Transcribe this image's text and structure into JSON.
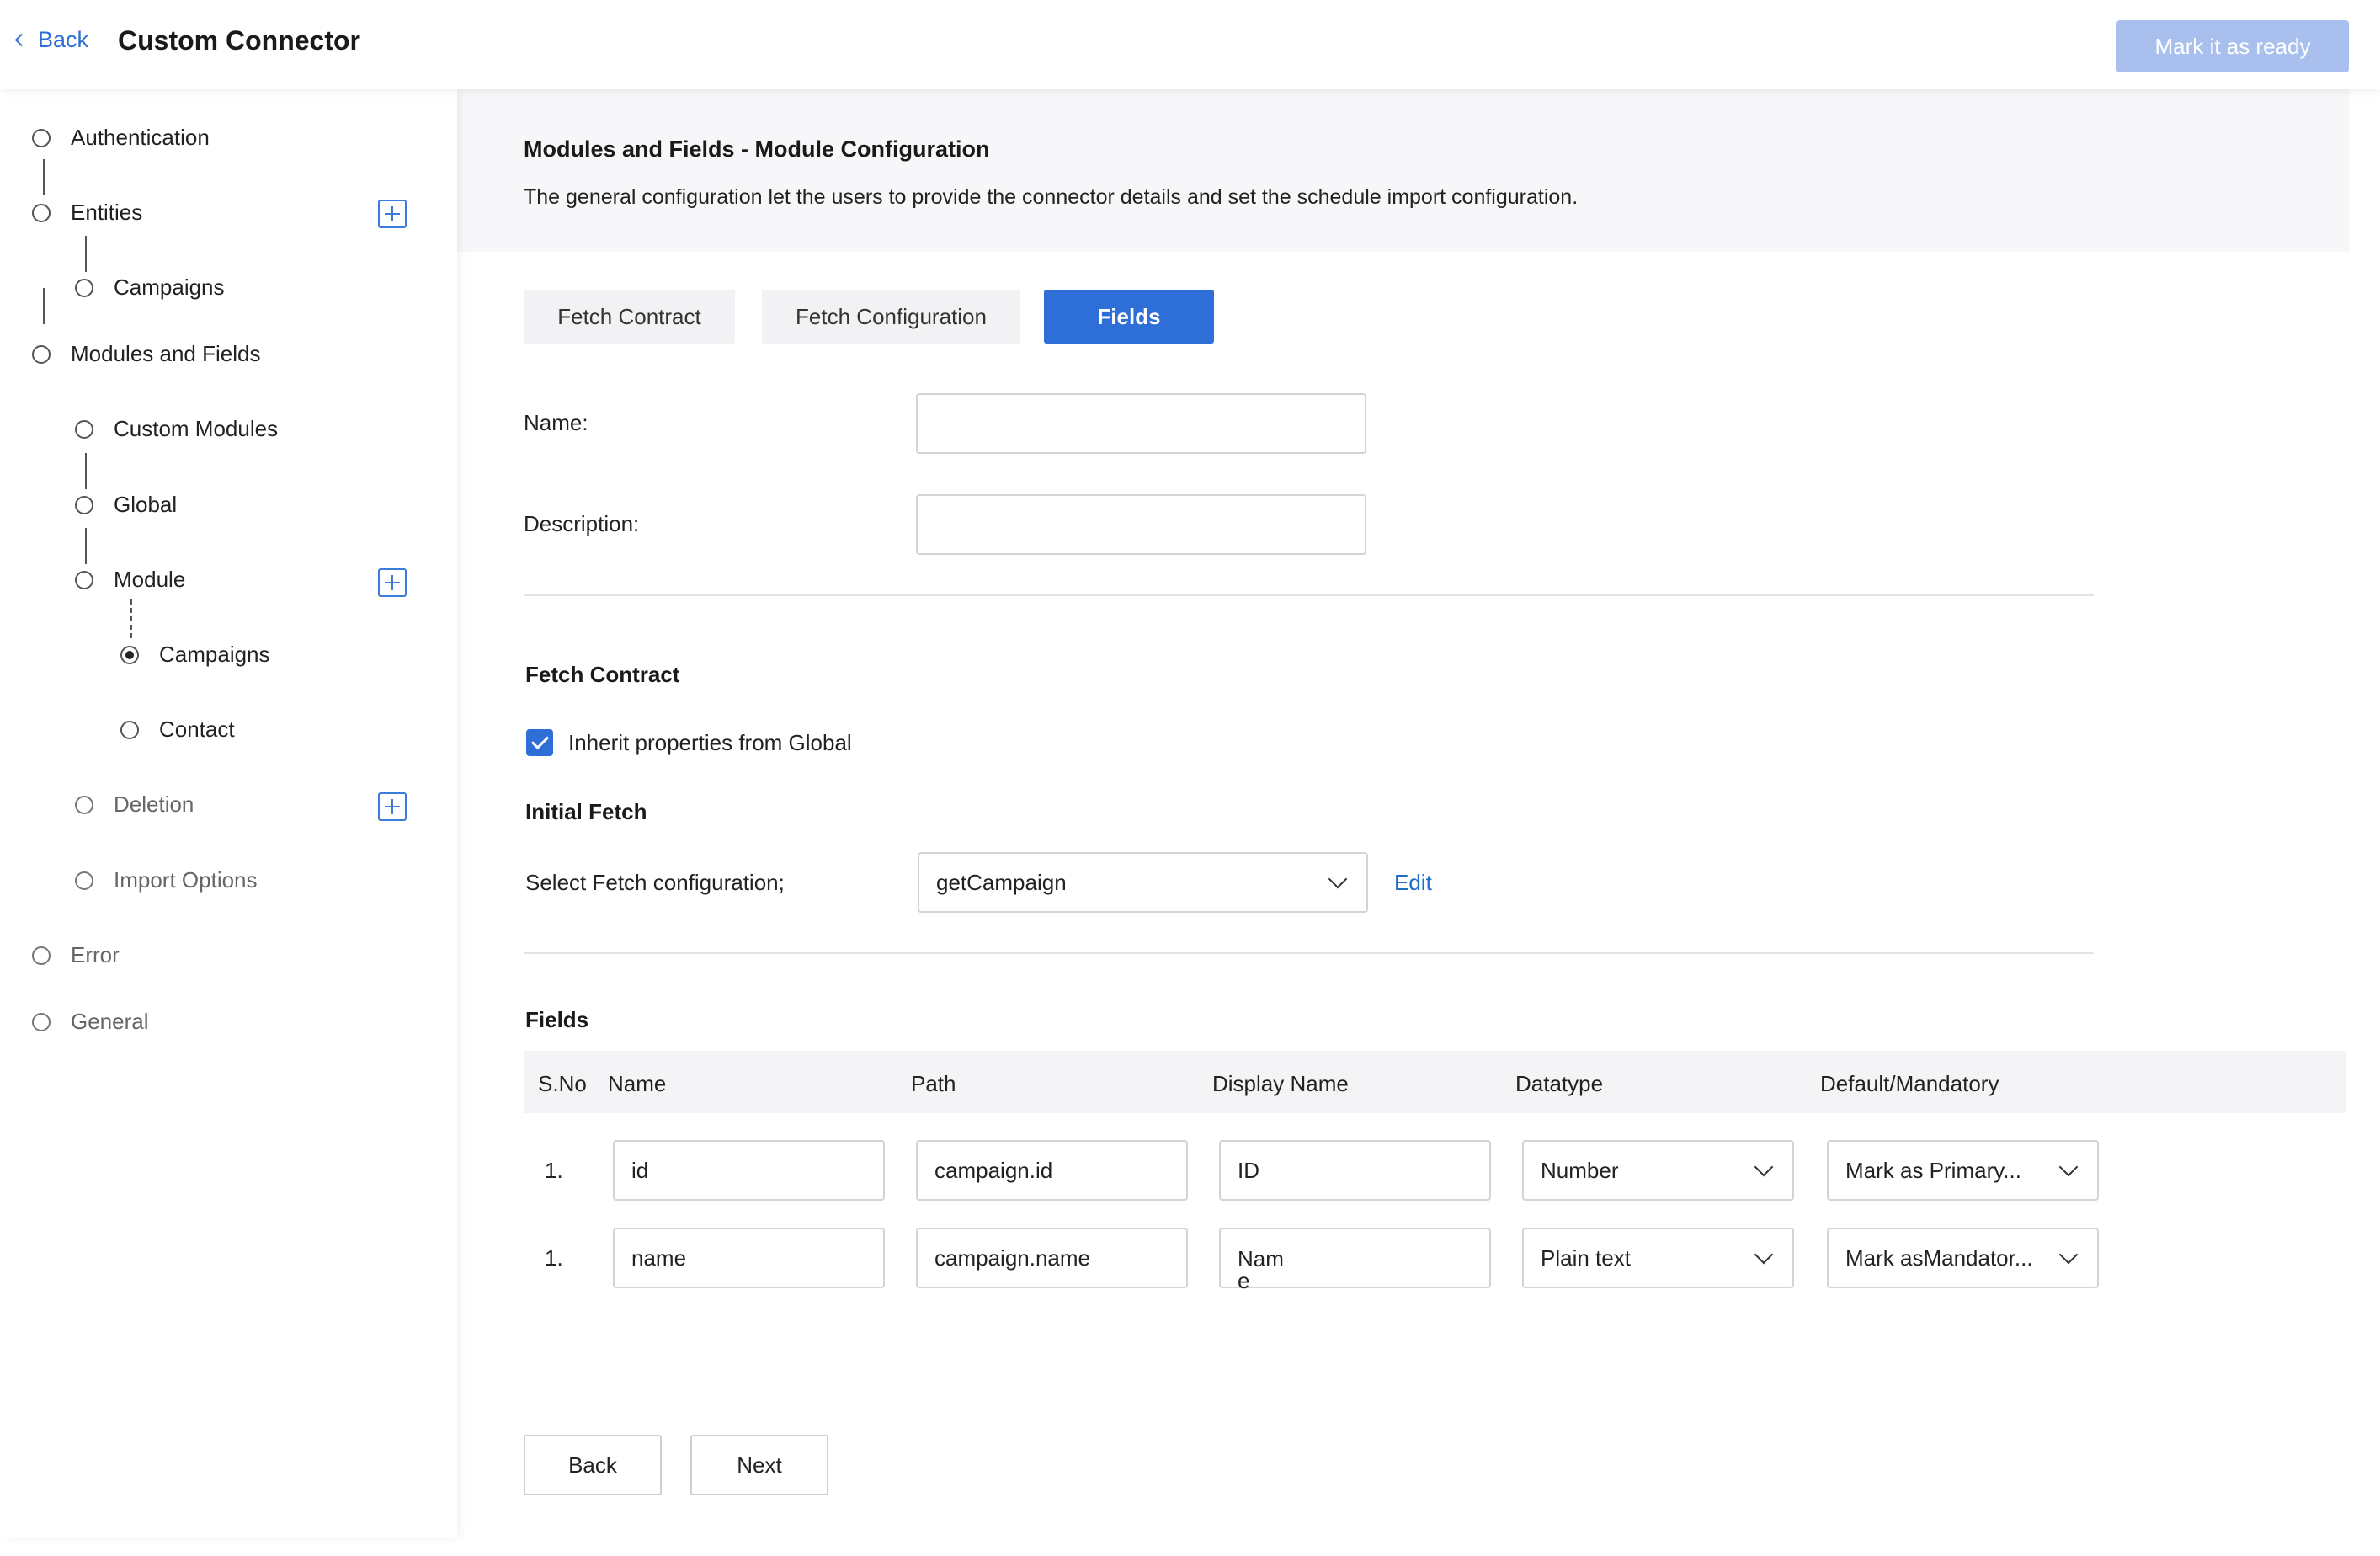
{
  "header": {
    "back_label": "Back",
    "title": "Custom Connector",
    "ready_label": "Mark it as ready"
  },
  "sidebar": {
    "authentication": "Authentication",
    "entities": "Entities",
    "entities_campaigns": "Campaigns",
    "modules_and_fields": "Modules and Fields",
    "custom_modules": "Custom Modules",
    "global": "Global",
    "module": "Module",
    "module_campaigns": "Campaigns",
    "module_contact": "Contact",
    "deletion": "Deletion",
    "import_options": "Import Options",
    "error": "Error",
    "general": "General"
  },
  "info": {
    "title": "Modules and Fields - Module Configuration",
    "description": "The general configuration let the users to provide the connector details and set the schedule import configuration."
  },
  "tabs": [
    "Fetch Contract",
    "Fetch Configuration",
    "Fields"
  ],
  "form": {
    "name_label": "Name:",
    "name_value": "",
    "description_label": "Description:",
    "description_value": ""
  },
  "fetch_contract": {
    "heading": "Fetch Contract",
    "inherit_label": "Inherit properties from Global",
    "initial_fetch_heading": "Initial Fetch",
    "select_label": "Select Fetch configuration;",
    "select_value": "getCampaign",
    "edit_label": "Edit"
  },
  "fields": {
    "heading": "Fields",
    "columns": [
      "S.No",
      "Name",
      "Path",
      "Display Name",
      "Datatype",
      "Default/Mandatory"
    ],
    "rows": [
      {
        "sno": "1.",
        "name": "id",
        "path": "campaign.id",
        "display": "ID",
        "datatype": "Number",
        "default": "Mark as Primary..."
      },
      {
        "sno": "1.",
        "name": "name",
        "path": "campaign.name",
        "display": "Nam",
        "display_wrap": "e",
        "datatype": "Plain text",
        "default": "Mark asMandator..."
      }
    ]
  },
  "footer": {
    "back_label": "Back",
    "next_label": "Next"
  },
  "colors": {
    "accent": "#2d6fd6",
    "ready_disabled": "#a9c0ef",
    "link": "#1e6ec8"
  }
}
